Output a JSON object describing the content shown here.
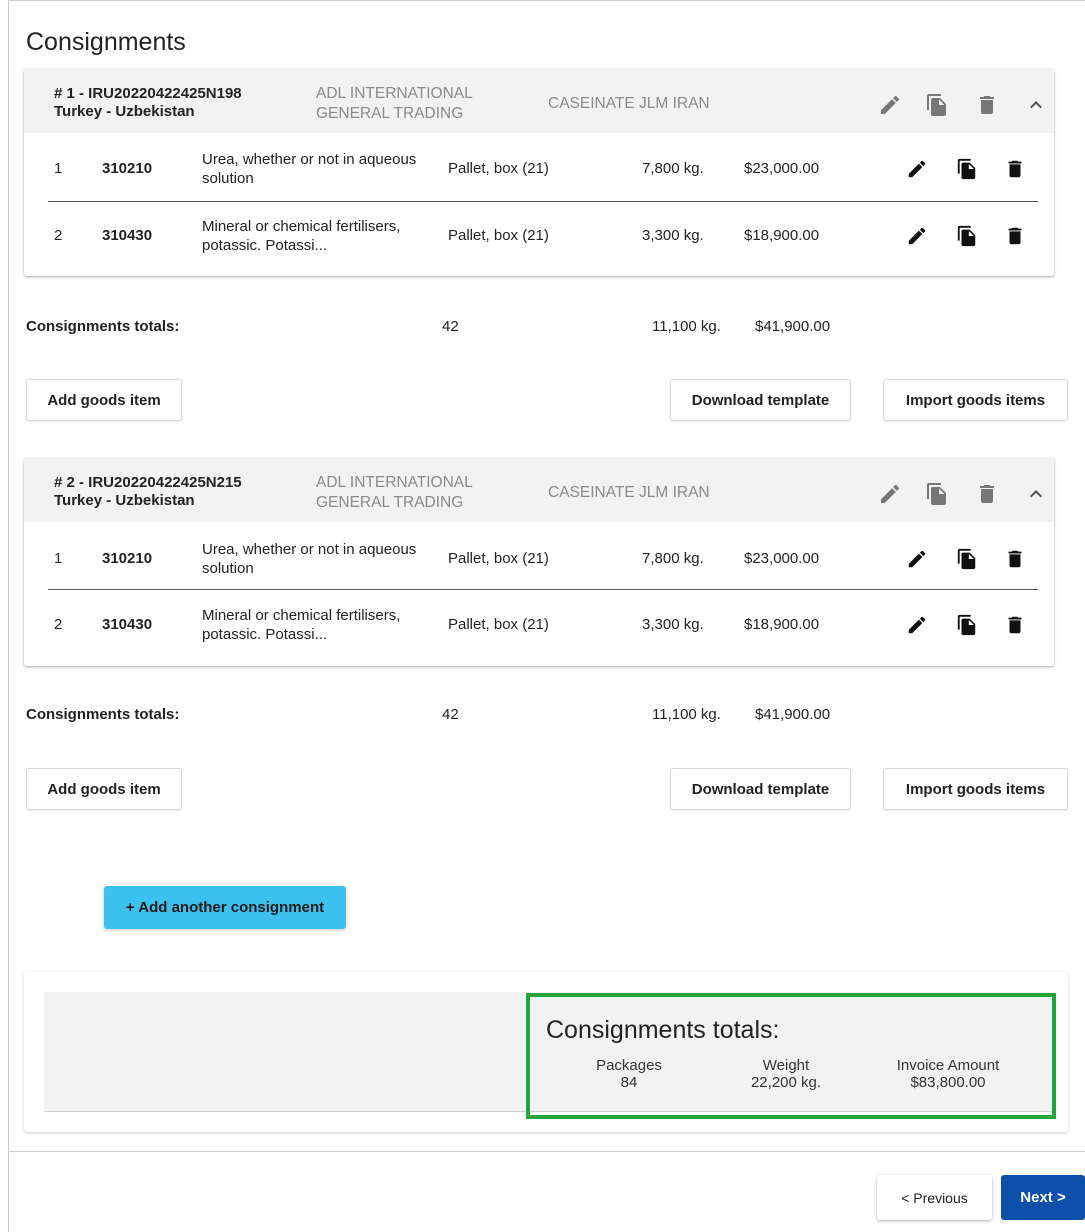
{
  "page": {
    "title": "Consignments"
  },
  "consignments": [
    {
      "id": "# 1 - IRU20220422425N198",
      "route": "Turkey - Uzbekistan",
      "company": "ADL INTERNATIONAL GENERAL TRADING",
      "goods": "CASEINATE JLM IRAN",
      "items": [
        {
          "num": "1",
          "code": "310210",
          "desc": "Urea, whether or not in aqueous solution",
          "packages": "Pallet, box (21)",
          "weight": "7,800 kg.",
          "amount": "$23,000.00"
        },
        {
          "num": "2",
          "code": "310430",
          "desc": "Mineral or chemical fertilisers, potassic. Potassi...",
          "packages": "Pallet, box (21)",
          "weight": "3,300 kg.",
          "amount": "$18,900.00"
        }
      ],
      "totals": {
        "label": "Consignments totals:",
        "packages": "42",
        "weight": "11,100 kg.",
        "amount": "$41,900.00"
      },
      "buttons": {
        "add": "Add goods item",
        "download": "Download template",
        "import": "Import goods items"
      }
    },
    {
      "id": "# 2 - IRU20220422425N215",
      "route": "Turkey - Uzbekistan",
      "company": "ADL INTERNATIONAL GENERAL TRADING",
      "goods": "CASEINATE JLM IRAN",
      "items": [
        {
          "num": "1",
          "code": "310210",
          "desc": "Urea, whether or not in aqueous solution",
          "packages": "Pallet, box (21)",
          "weight": "7,800 kg.",
          "amount": "$23,000.00"
        },
        {
          "num": "2",
          "code": "310430",
          "desc": "Mineral or chemical fertilisers, potassic. Potassi...",
          "packages": "Pallet, box (21)",
          "weight": "3,300 kg.",
          "amount": "$18,900.00"
        }
      ],
      "totals": {
        "label": "Consignments totals:",
        "packages": "42",
        "weight": "11,100 kg.",
        "amount": "$41,900.00"
      },
      "buttons": {
        "add": "Add goods item",
        "download": "Download template",
        "import": "Import goods items"
      }
    }
  ],
  "add_consignment_label": "+ Add another consignment",
  "summary": {
    "title": "Consignments totals:",
    "packages_label": "Packages",
    "packages_value": "84",
    "weight_label": "Weight",
    "weight_value": "22,200 kg.",
    "amount_label": "Invoice Amount",
    "amount_value": "$83,800.00"
  },
  "nav": {
    "previous": "< Previous",
    "next": "Next >"
  },
  "icons": {
    "edit": "pencil-icon",
    "copy": "copy-icon",
    "delete": "trash-icon",
    "collapse": "chevron-up-icon"
  },
  "colors": {
    "accent_button": "#3cc0ee",
    "primary": "#0b4fa8",
    "highlight": "#22a63a",
    "header_bg": "#f2f2f2",
    "muted_text": "#8a8a8a"
  }
}
